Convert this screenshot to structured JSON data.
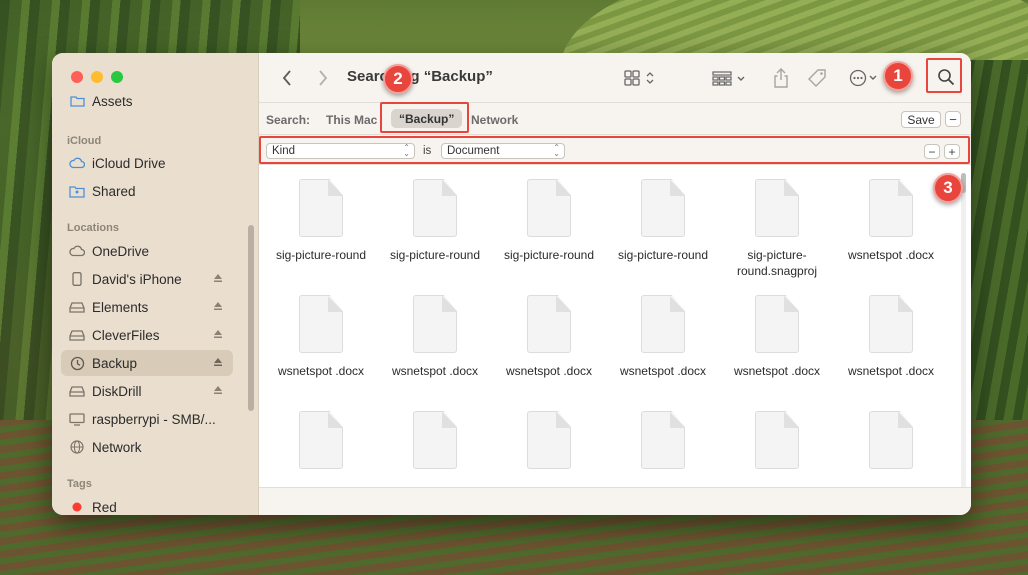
{
  "window": {
    "title": "Searching “Backup”"
  },
  "sidebar": {
    "partial_top_item": "Assets",
    "sections": [
      {
        "header": "iCloud",
        "items": [
          "iCloud Drive",
          "Shared"
        ]
      },
      {
        "header": "Locations",
        "items": [
          "OneDrive",
          "David's iPhone",
          "Elements",
          "CleverFiles",
          "Backup",
          "DiskDrill",
          "raspberrypi - SMB/...",
          "Network"
        ]
      },
      {
        "header": "Tags",
        "items": [
          "Red"
        ]
      }
    ],
    "selected": "Backup",
    "tag_colors": {
      "Red": "#ff3b30"
    }
  },
  "scope_bar": {
    "label": "Search:",
    "options": [
      "This Mac",
      "“Backup”",
      "Network"
    ],
    "selected": "“Backup”",
    "save_label": "Save"
  },
  "criteria": {
    "attribute": "Kind",
    "operator": "is",
    "value": "Document"
  },
  "files": [
    {
      "name": "sig-picture-round"
    },
    {
      "name": "sig-picture-round"
    },
    {
      "name": "sig-picture-round"
    },
    {
      "name": "sig-picture-round"
    },
    {
      "name": "sig-picture-round.snagproj"
    },
    {
      "name": "wsnetspot .docx"
    },
    {
      "name": "wsnetspot .docx"
    },
    {
      "name": "wsnetspot .docx"
    },
    {
      "name": "wsnetspot .docx"
    },
    {
      "name": "wsnetspot .docx"
    },
    {
      "name": "wsnetspot .docx"
    },
    {
      "name": "wsnetspot .docx"
    },
    {
      "name": ""
    },
    {
      "name": ""
    },
    {
      "name": ""
    },
    {
      "name": ""
    },
    {
      "name": ""
    },
    {
      "name": ""
    }
  ],
  "annotations": {
    "badge1": "1",
    "badge2": "2",
    "badge3": "3",
    "color": "#e8453c"
  }
}
